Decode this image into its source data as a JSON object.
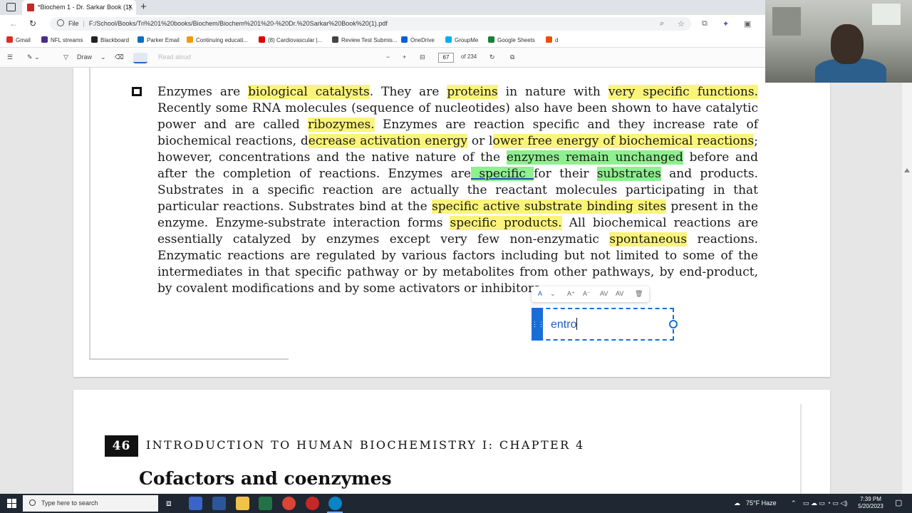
{
  "browser": {
    "tab_title": "*Biochem 1 - Dr. Sarkar Book (1).",
    "tab_close": "×",
    "new_tab": "+",
    "url_scheme": "File",
    "url": "F:/School/Books/Tri%201%20books/Biochem/Biochem%201%20-%20Dr.%20Sarkar%20Book%20(1).pdf"
  },
  "bookmarks": [
    {
      "label": "Gmail",
      "color": "#d93025"
    },
    {
      "label": "NFL streams",
      "color": "#4a2c8a"
    },
    {
      "label": "Blackboard",
      "color": "#222222"
    },
    {
      "label": "Parker Email",
      "color": "#0f6cbd"
    },
    {
      "label": "Continuing educati...",
      "color": "#f29900"
    },
    {
      "label": "(8) Cardiovascular |...",
      "color": "#e00000"
    },
    {
      "label": "Review Test Submis...",
      "color": "#444444"
    },
    {
      "label": "OneDrive",
      "color": "#0a62c9"
    },
    {
      "label": "GroupMe",
      "color": "#00aff0"
    },
    {
      "label": "Google Sheets",
      "color": "#188038"
    },
    {
      "label": "d",
      "color": "#e65100"
    }
  ],
  "pdf_toolbar": {
    "draw_label": "Draw",
    "read_aloud_label": "Read aloud",
    "zoom_out": "−",
    "zoom_in": "+",
    "page_current": "67",
    "page_total": "of 234"
  },
  "document": {
    "paragraph": [
      {
        "t": "Enzymes are ",
        "h": ""
      },
      {
        "t": "biological catalysts",
        "h": "y"
      },
      {
        "t": ". They are ",
        "h": ""
      },
      {
        "t": "proteins",
        "h": "y"
      },
      {
        "t": " in nature with ",
        "h": ""
      },
      {
        "t": "very specific functions.",
        "h": "y"
      },
      {
        "t": " Recently some RNA molecules (sequence of nucleotides) also have been shown to have catalytic power and are called ",
        "h": ""
      },
      {
        "t": "ribozymes.",
        "h": "y"
      },
      {
        "t": " Enzymes are reaction specific and they increase rate of biochemical reactions, d",
        "h": ""
      },
      {
        "t": "ecrease activation energy",
        "h": "y"
      },
      {
        "t": " or l",
        "h": ""
      },
      {
        "t": "ower free energy of  biochemical reactions",
        "h": "y"
      },
      {
        "t": "; however, concentrations and the native nature of the ",
        "h": ""
      },
      {
        "t": "enzymes remain unchanged",
        "h": "g"
      },
      {
        "t": " before and after the completion of reactions. Enzymes are",
        "h": ""
      },
      {
        "t": " specific ",
        "h": "gu"
      },
      {
        "t": "for their ",
        "h": ""
      },
      {
        "t": "substrates",
        "h": "g"
      },
      {
        "t": " and products. Substrates in a specific reaction are actually the reactant molecules participating in that particular reactions. Substrates bind at the ",
        "h": ""
      },
      {
        "t": "specific active substrate binding sites",
        "h": "y"
      },
      {
        "t": " present in the enzyme. Enzyme-substrate interaction forms ",
        "h": ""
      },
      {
        "t": "specific products.",
        "h": "y"
      },
      {
        "t": " All biochemical reactions are essentially catalyzed by enzymes except very few non-enzymatic ",
        "h": ""
      },
      {
        "t": "spontaneous",
        "h": "y"
      },
      {
        "t": " reactions. Enzymatic reactions are regulated by various factors including but not limited to some of the intermediates in that specific pathway or by metabolites from other pathways, by end-product, by covalent modifications and by some activators or inhibitors.",
        "h": ""
      }
    ],
    "editor_text": "entro",
    "page_number": "46",
    "chapter_header": "INTRODUCTION TO HUMAN BIOCHEMISTRY I: CHAPTER 4",
    "section_title": "Cofactors and coenzymes"
  },
  "taskbar": {
    "search_placeholder": "Type here to search",
    "weather": "75°F  Haze",
    "time": "7:39 PM",
    "date": "5/20/2023"
  },
  "colors": {
    "highlight_yellow": "#fbf47a",
    "highlight_green": "#8ef08f",
    "editor_accent": "#1a6dd6",
    "taskbar_bg": "#1f2732"
  }
}
